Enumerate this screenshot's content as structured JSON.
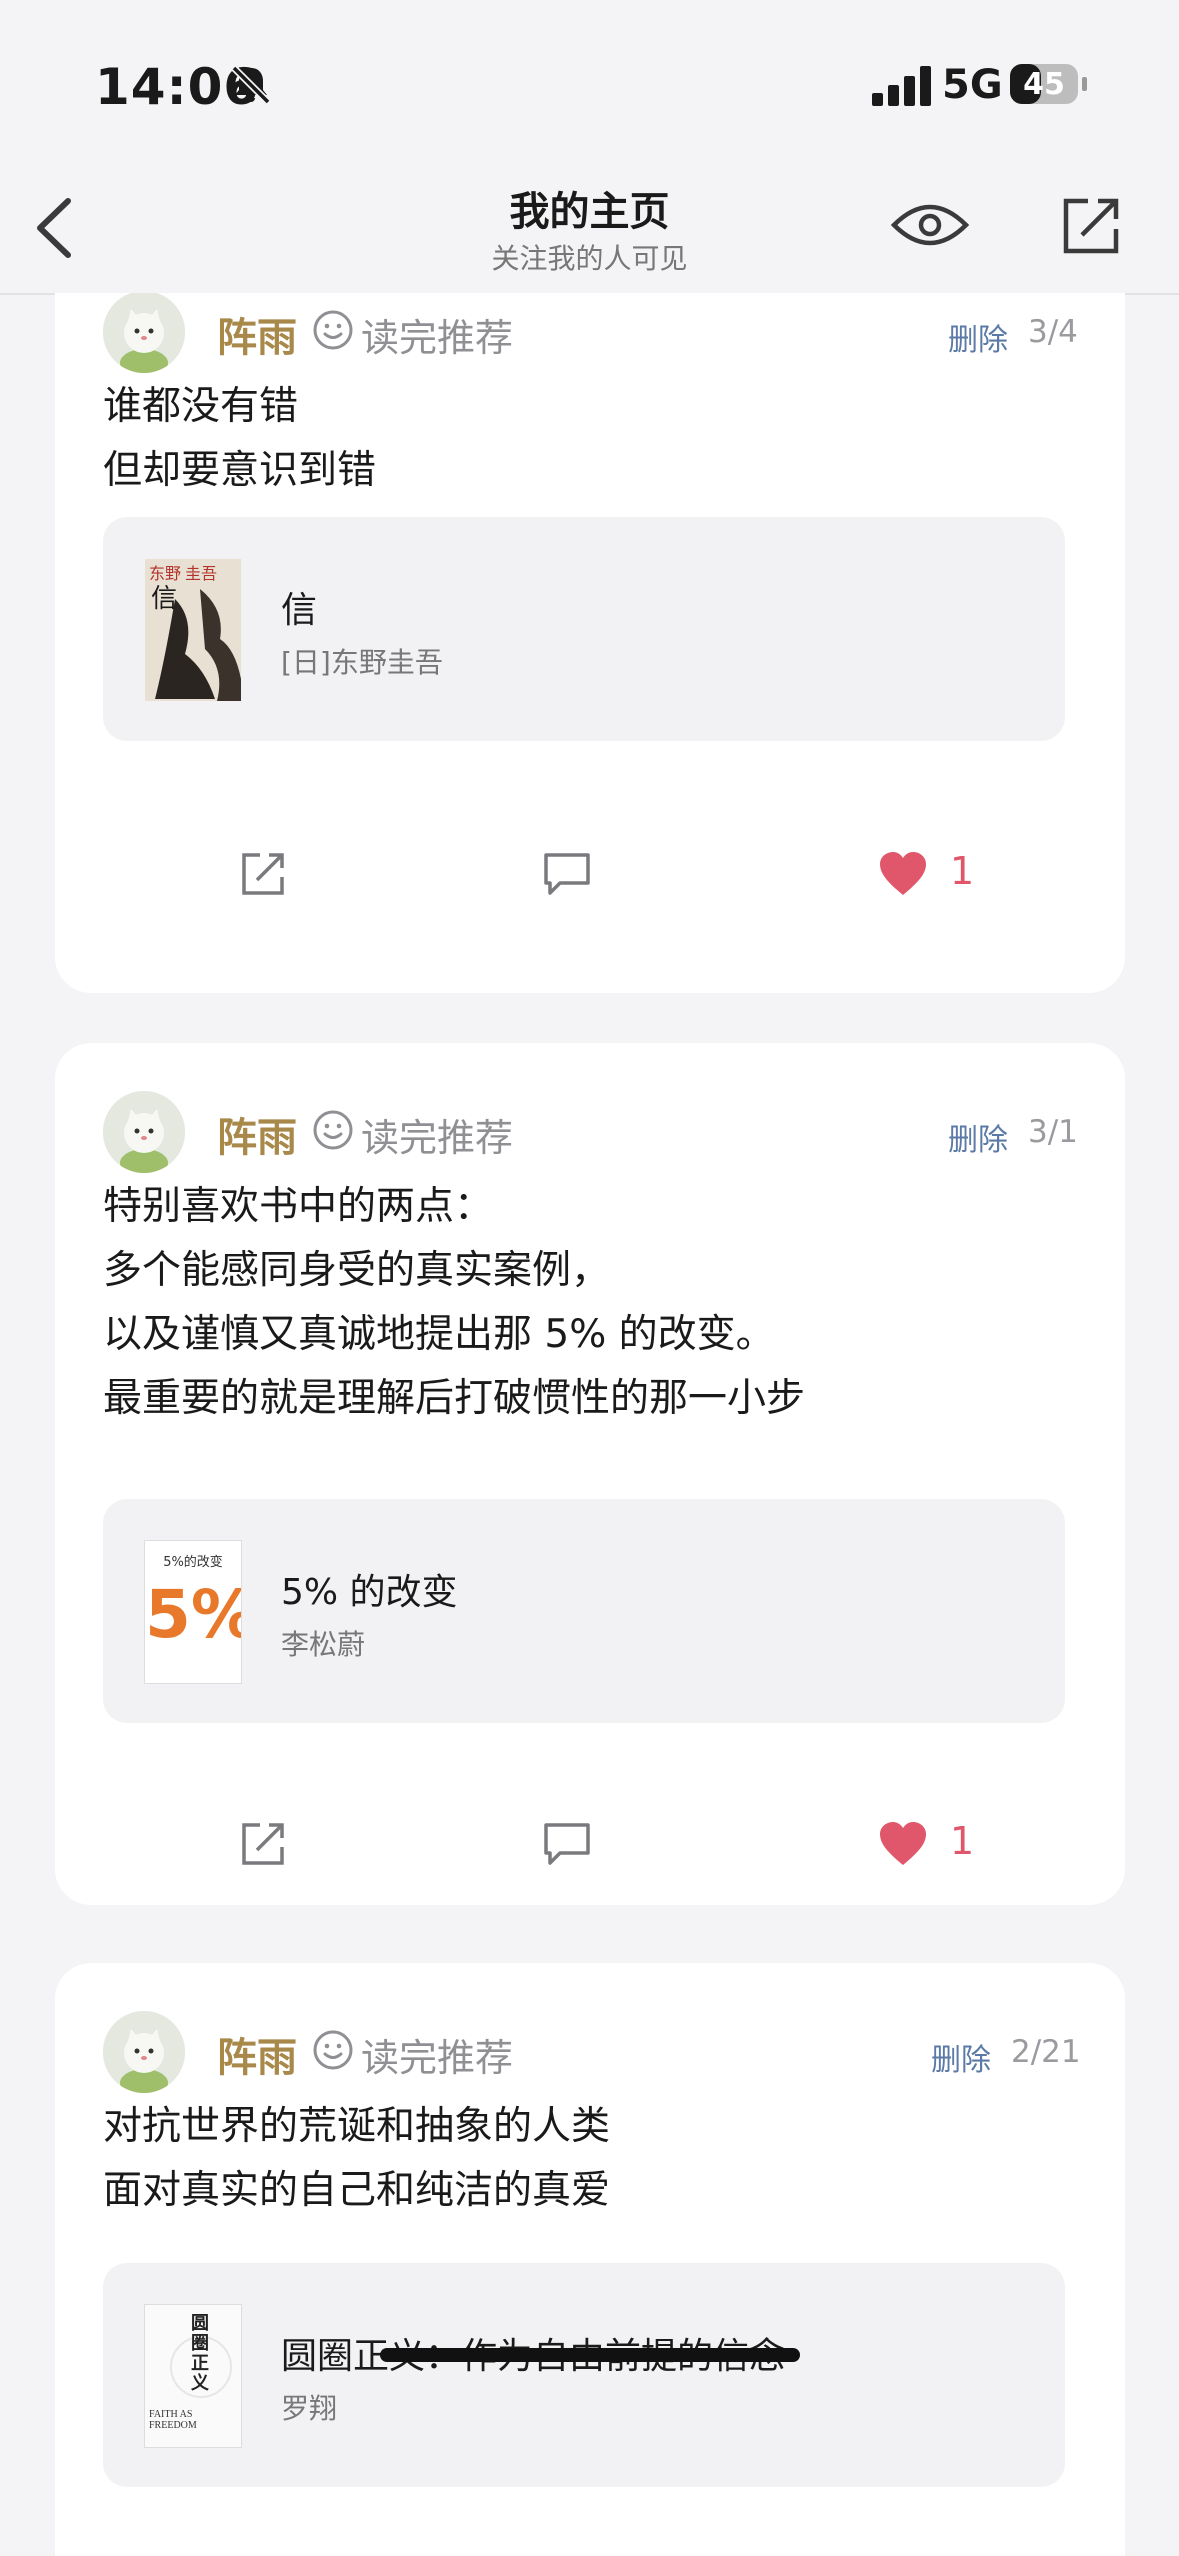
{
  "status": {
    "time": "14:06",
    "network": "5G",
    "battery": "45",
    "battery_level": 0.45
  },
  "nav": {
    "title": "我的主页",
    "subtitle": "关注我的人可见"
  },
  "posts": [
    {
      "author": "阵雨",
      "tag": "读完推荐",
      "delete_label": "删除",
      "date": "3/4",
      "lines": [
        "谁都没有错",
        "但却要意识到错"
      ],
      "book": {
        "title": "信",
        "author": "[日]东野圭吾",
        "cover_text": "东野圭吾 信"
      },
      "likes": "1"
    },
    {
      "author": "阵雨",
      "tag": "读完推荐",
      "delete_label": "删除",
      "date": "3/1",
      "lines": [
        "特别喜欢书中的两点：",
        "多个能感同身受的真实案例，",
        "以及谨慎又真诚地提出那 5% 的改变。",
        "最重要的就是理解后打破惯性的那一小步"
      ],
      "book": {
        "title": "5% 的改变",
        "author": "李松蔚",
        "cover_text": "5%的改变",
        "cover_big": "5%"
      },
      "likes": "1"
    },
    {
      "author": "阵雨",
      "tag": "读完推荐",
      "delete_label": "删除",
      "date": "2/21",
      "lines": [
        "对抗世界的荒诞和抽象的人类",
        "面对真实的自己和纯洁的真爱"
      ],
      "book": {
        "title": "圆圈正义：作为自由前提的信念",
        "author": "罗翔",
        "cover_text": "圆圈正义",
        "cover_en": "FAITH AS FREEDOM"
      }
    }
  ],
  "colors": {
    "author": "#a8894a",
    "like": "#e0566a",
    "delete": "#5b7aa6",
    "background": "#f4f4f6"
  }
}
